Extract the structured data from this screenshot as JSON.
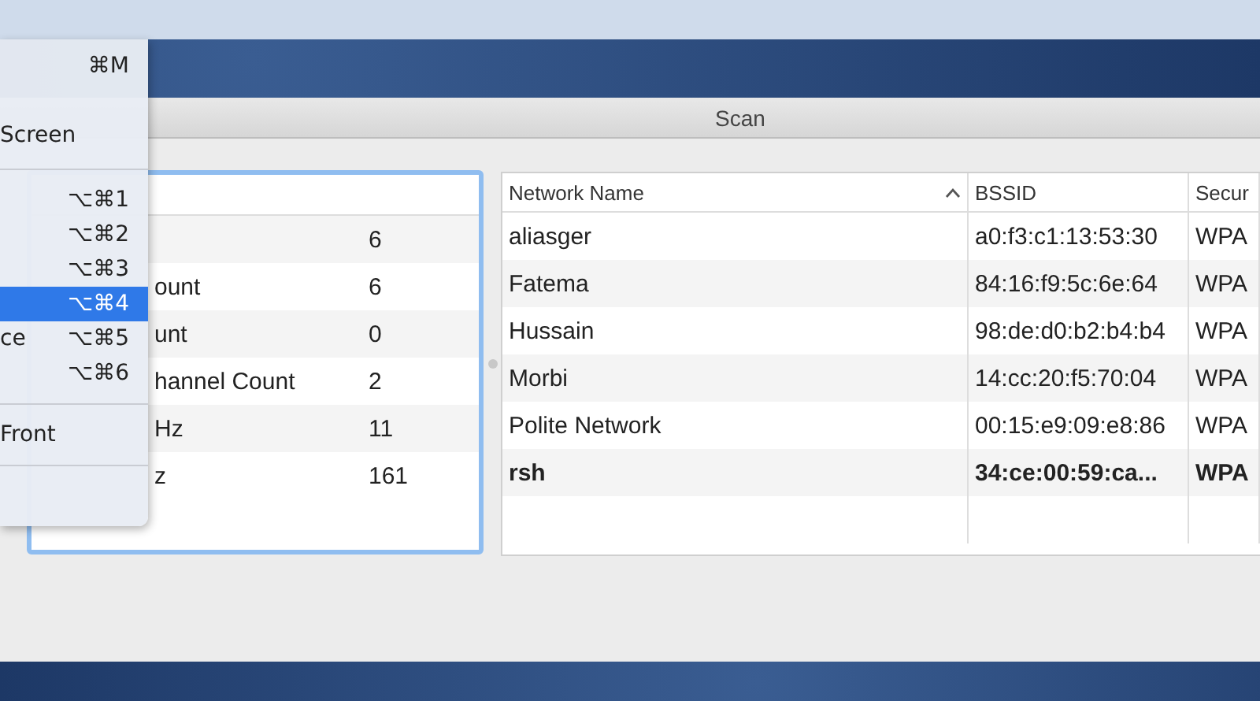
{
  "menu": {
    "items": [
      {
        "kind": "item",
        "shortcut": "⌘M",
        "selected": false
      },
      {
        "kind": "item",
        "label": "Screen",
        "selected": false
      },
      {
        "kind": "separator"
      },
      {
        "kind": "item",
        "shortcut": "⌥⌘1",
        "selected": false
      },
      {
        "kind": "item",
        "shortcut": "⌥⌘2",
        "selected": false
      },
      {
        "kind": "item",
        "shortcut": "⌥⌘3",
        "selected": false
      },
      {
        "kind": "item",
        "shortcut": "⌥⌘4",
        "selected": true
      },
      {
        "kind": "item",
        "label": "ce",
        "shortcut": "⌥⌘5",
        "selected": false
      },
      {
        "kind": "item",
        "shortcut": "⌥⌘6",
        "selected": false
      },
      {
        "kind": "separator"
      },
      {
        "kind": "item",
        "label": "Front",
        "selected": false
      },
      {
        "kind": "separator"
      }
    ]
  },
  "window": {
    "title": "Scan"
  },
  "summary_table": {
    "rows": [
      {
        "label": "",
        "value": "6"
      },
      {
        "label": "ount",
        "value": "6"
      },
      {
        "label": "unt",
        "value": "0"
      },
      {
        "label": "hannel Count",
        "value": "2"
      },
      {
        "label": "Hz",
        "value": "11"
      },
      {
        "label": "z",
        "value": "161"
      }
    ]
  },
  "networks_table": {
    "columns": [
      {
        "label": "Network Name",
        "sorted": true
      },
      {
        "label": "BSSID",
        "sorted": false
      },
      {
        "label": "Secur",
        "sorted": false
      }
    ],
    "rows": [
      {
        "cells": [
          "aliasger",
          "a0:f3:c1:13:53:30",
          "WPA"
        ],
        "connected": false
      },
      {
        "cells": [
          "Fatema",
          "84:16:f9:5c:6e:64",
          "WPA"
        ],
        "connected": false
      },
      {
        "cells": [
          "Hussain",
          "98:de:d0:b2:b4:b4",
          "WPA"
        ],
        "connected": false
      },
      {
        "cells": [
          "Morbi",
          "14:cc:20:f5:70:04",
          "WPA"
        ],
        "connected": false
      },
      {
        "cells": [
          "Polite Network",
          "00:15:e9:09:e8:86",
          "WPA"
        ],
        "connected": false
      },
      {
        "cells": [
          "rsh",
          "34:ce:00:59:ca...",
          "WPA"
        ],
        "connected": true
      }
    ]
  }
}
